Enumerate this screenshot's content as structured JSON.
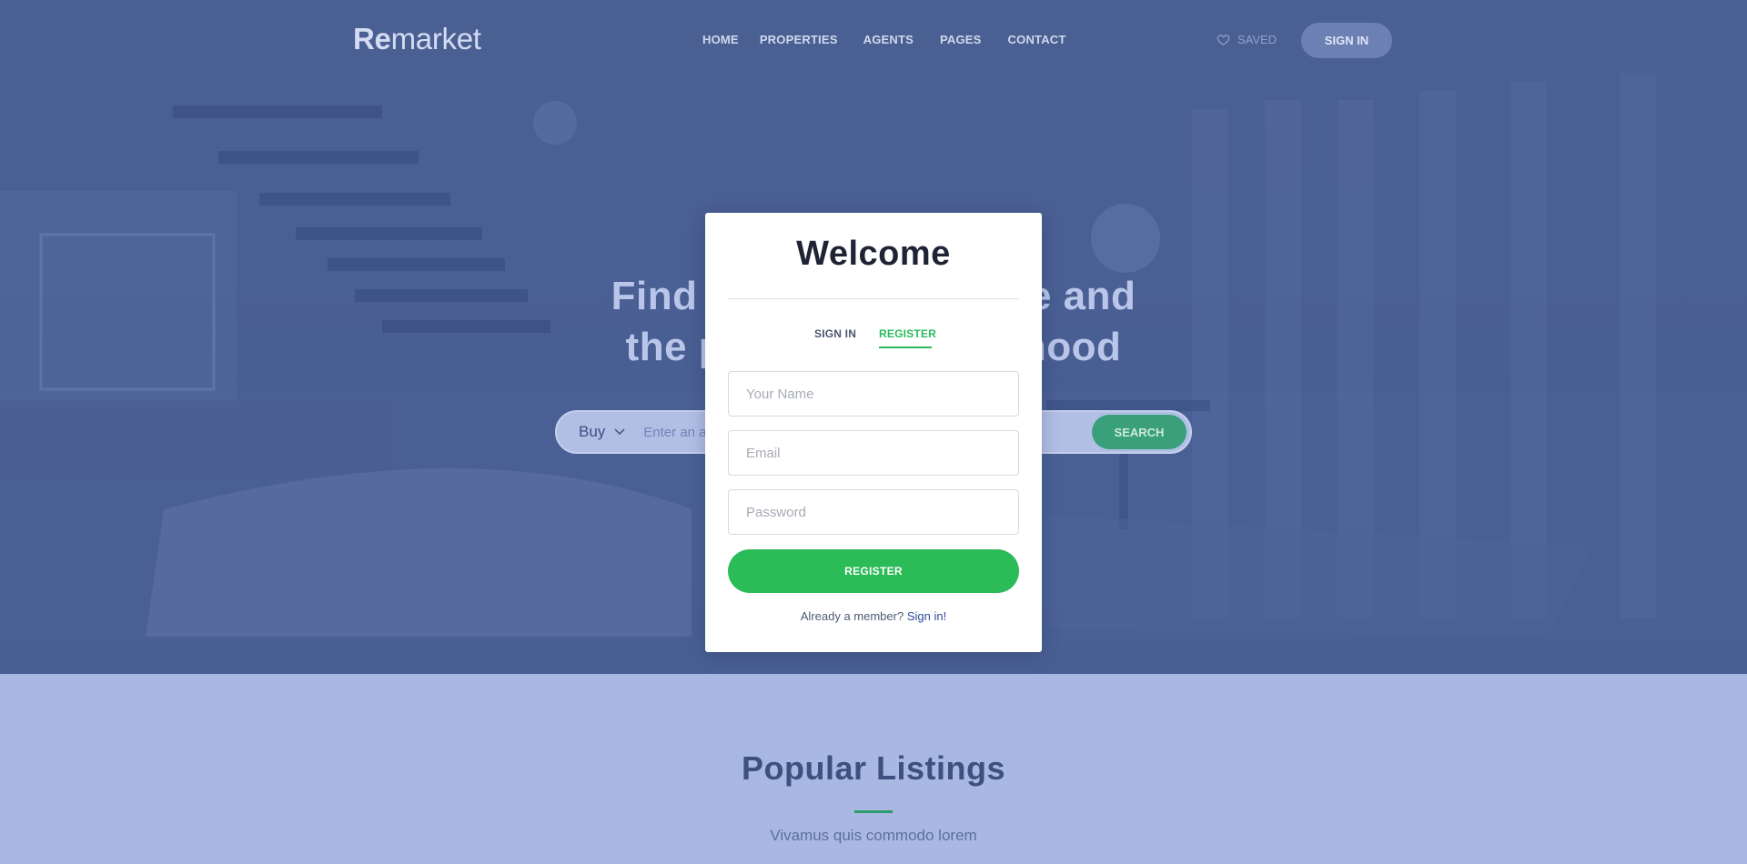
{
  "header": {
    "brand_bold": "Re",
    "brand_rest": "market",
    "nav": [
      {
        "label": "HOME"
      },
      {
        "label": "PROPERTIES"
      },
      {
        "label": "AGENTS"
      },
      {
        "label": "PAGES"
      },
      {
        "label": "CONTACT"
      }
    ],
    "saved_label": "SAVED",
    "saved_icon": "heart-icon",
    "signin_label": "SIGN IN"
  },
  "hero": {
    "headline_line1": "Find your dream home and",
    "headline_line2": "the perfect neighborhood",
    "search": {
      "type_value": "Buy",
      "placeholder": "Enter an address, neighborhood, city, or ZIP code",
      "button_label": "SEARCH"
    }
  },
  "modal": {
    "title": "Welcome",
    "tabs": [
      {
        "label": "SIGN IN",
        "active": false
      },
      {
        "label": "REGISTER",
        "active": true
      }
    ],
    "fields": {
      "name_placeholder": "Your Name",
      "email_placeholder": "Email",
      "password_placeholder": "Password"
    },
    "submit_label": "REGISTER",
    "member_text": "Already a member?",
    "member_link": "Sign in!"
  },
  "listings": {
    "title": "Popular Listings",
    "subtitle": "Vivamus quis commodo lorem"
  },
  "colors": {
    "accent_green": "#2bbb57",
    "overlay_blue": "#4a5f93",
    "section_bg": "#a9b8e2"
  }
}
